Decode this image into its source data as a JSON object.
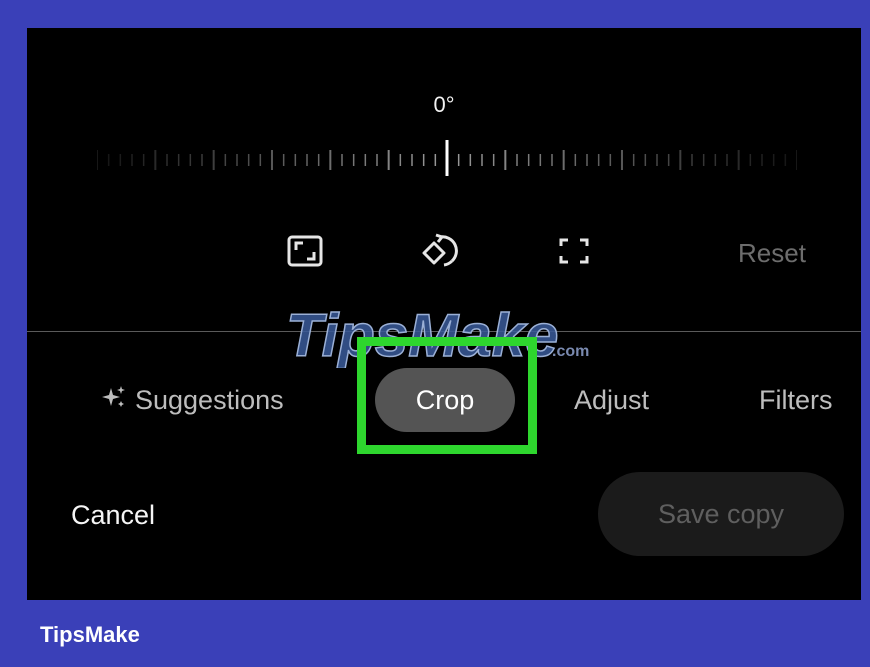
{
  "editor": {
    "rotation_angle": "0°",
    "tools": [
      {
        "icon": "aspect-ratio-icon"
      },
      {
        "icon": "rotate-icon"
      },
      {
        "icon": "free-crop-icon"
      }
    ],
    "reset_label": "Reset",
    "tabs": [
      {
        "label": "Suggestions",
        "icon": "sparkle-icon",
        "active": false
      },
      {
        "label": "Crop",
        "active": true
      },
      {
        "label": "Adjust",
        "active": false
      },
      {
        "label": "Filters",
        "active": false
      }
    ],
    "cancel_label": "Cancel",
    "save_label": "Save copy"
  },
  "watermark": {
    "text": "TipsMake",
    "suffix": ".com"
  },
  "footer": {
    "brand": "TipsMake"
  },
  "colors": {
    "frame": "#3a40b8",
    "screen": "#000000",
    "highlight": "#2ed62e",
    "active_tab": "#545454"
  }
}
